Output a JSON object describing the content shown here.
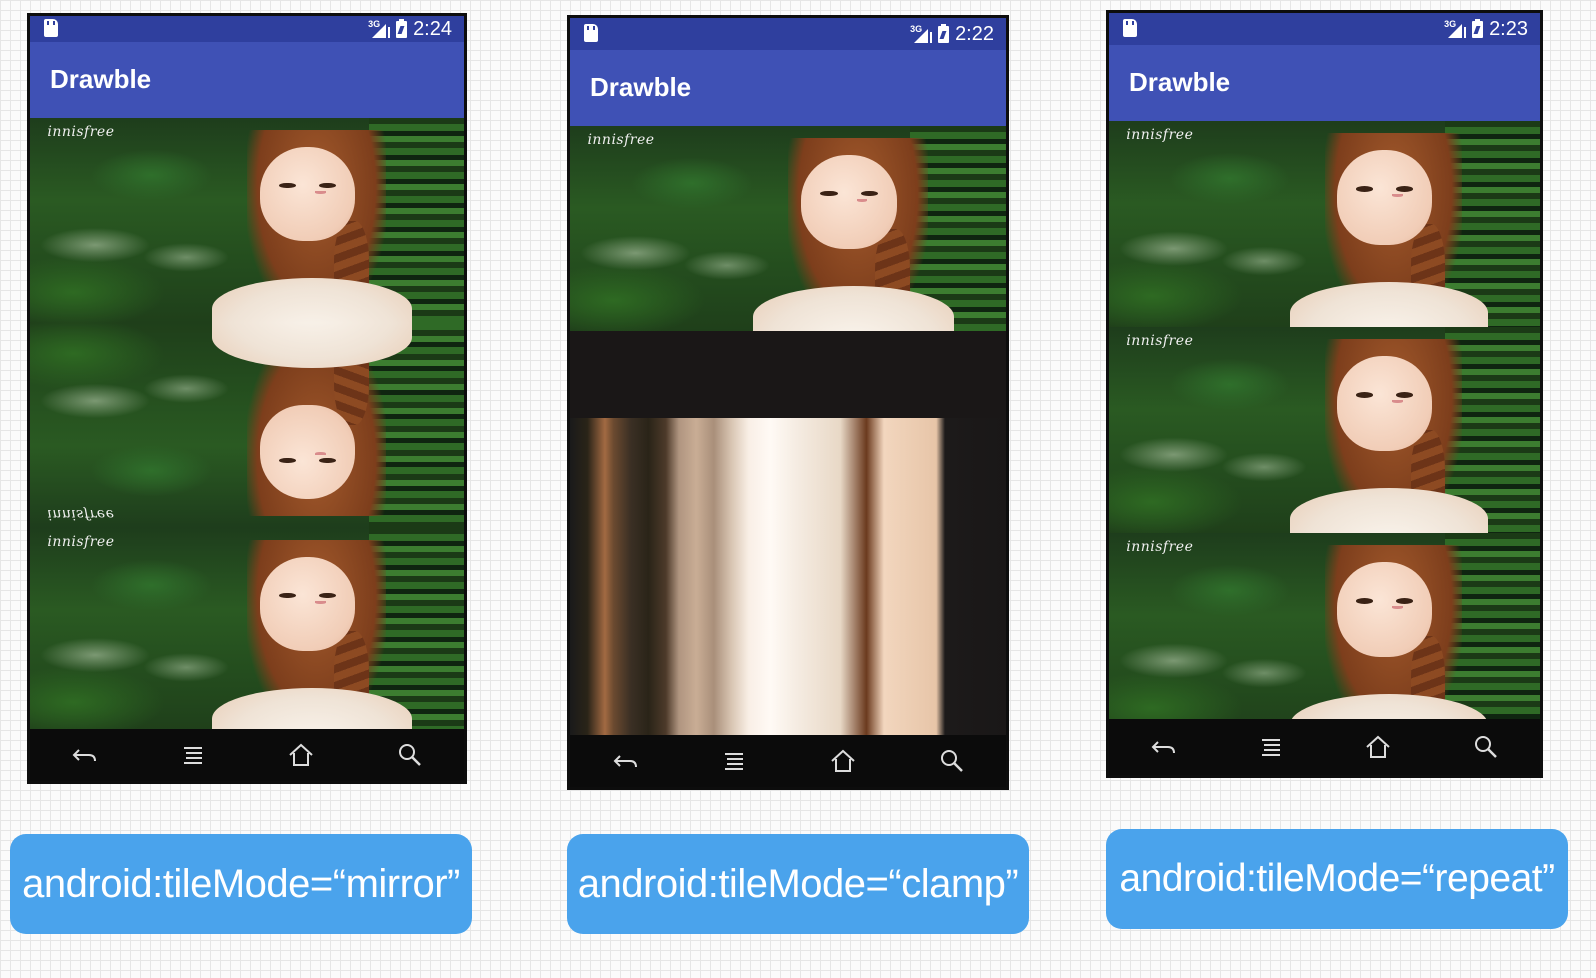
{
  "colors": {
    "statusbar": "#2f3f9e",
    "toolbar": "#3f51b5",
    "navbar": "#0b0b0b",
    "label_background": "#4aa3ec",
    "label_text": "#ffffff"
  },
  "phones": [
    {
      "time": "2:24",
      "network": "3G",
      "app_title": "Drawble",
      "brand_text": "innisfree",
      "tile_mode": "mirror",
      "label": "android:tileMode=“mirror”"
    },
    {
      "time": "2:22",
      "network": "3G",
      "app_title": "Drawble",
      "brand_text": "innisfree",
      "tile_mode": "clamp",
      "label": "android:tileMode=“clamp”"
    },
    {
      "time": "2:23",
      "network": "3G",
      "app_title": "Drawble",
      "brand_text": "innisfree",
      "tile_mode": "repeat",
      "label": "android:tileMode=“repeat”"
    }
  ],
  "navbar_icons": [
    "back-icon",
    "menu-icon",
    "home-icon",
    "search-icon"
  ]
}
